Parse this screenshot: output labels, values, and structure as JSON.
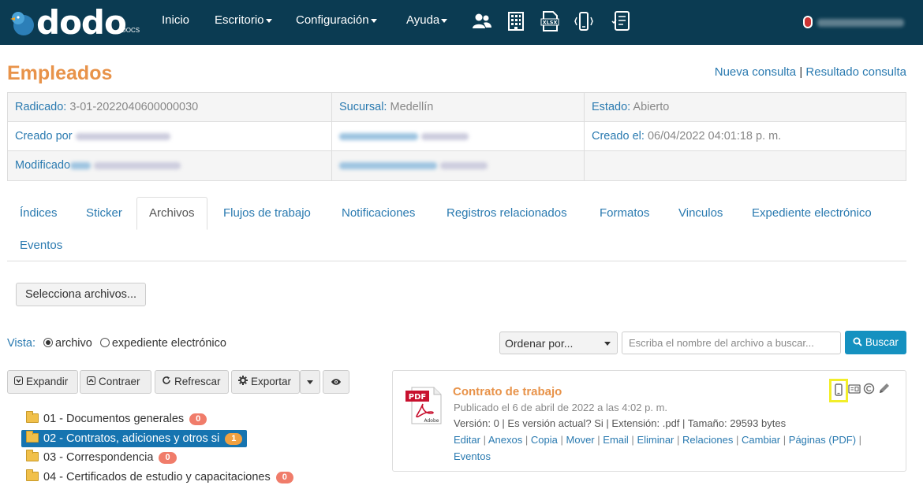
{
  "topbar": {
    "brand": "dodo",
    "brand_sub": "DOCS",
    "nav": [
      {
        "label": "Inicio"
      },
      {
        "label": "Escritorio"
      },
      {
        "label": "Configuración"
      },
      {
        "label": "Ayuda"
      }
    ],
    "icons": [
      "users-icon",
      "building-icon",
      "xlsx-icon",
      "mobile-vibrate-icon",
      "checklist-icon"
    ]
  },
  "page": {
    "title": "Empleados",
    "link_new": "Nueva consulta",
    "link_sep": "|",
    "link_result": "Resultado consulta"
  },
  "info": {
    "radicado_label": "Radicado:",
    "radicado_value": "3-01-2022040600000030",
    "sucursal_label": "Sucursal:",
    "sucursal_value": "Medellín",
    "estado_label": "Estado:",
    "estado_value": "Abierto",
    "creado_por_label": "Creado por",
    "creado_el_label": "Creado el:",
    "creado_el_value": "06/04/2022 04:01:18 p. m.",
    "modificado_label": "Modificado"
  },
  "tabs": [
    {
      "label": "Índices"
    },
    {
      "label": "Sticker"
    },
    {
      "label": "Archivos"
    },
    {
      "label": "Flujos de trabajo"
    },
    {
      "label": "Notificaciones"
    },
    {
      "label": "Registros relacionados"
    },
    {
      "label": "Formatos"
    },
    {
      "label": "Vinculos"
    },
    {
      "label": "Expediente electrónico"
    },
    {
      "label": "Eventos"
    }
  ],
  "files": {
    "select_button": "Selecciona archivos...",
    "vista_label": "Vista:",
    "vista_option1": "archivo",
    "vista_option2": "expediente electrónico",
    "sort_label": "Ordenar por...",
    "search_placeholder": "Escriba el nombre del archivo a buscar...",
    "search_button": "Buscar"
  },
  "toolbar": {
    "expand": "Expandir",
    "collapse": "Contraer",
    "refresh": "Refrescar",
    "export": "Exportar"
  },
  "tree": [
    {
      "label": "01 - Documentos generales",
      "count": "0"
    },
    {
      "label": "02 - Contratos, adiciones y otros si",
      "count": "1"
    },
    {
      "label": "03 - Correspondencia",
      "count": "0"
    },
    {
      "label": "04 - Certificados de estudio y capacitaciones",
      "count": "0"
    }
  ],
  "file": {
    "title": "Contrato de trabajo",
    "published": "Publicado el 6 de abril de 2022 a las 4:02 p. m.",
    "details": "Versión: 0 | Es versión actual? Si | Extensión: .pdf | Tamaño: 29593 bytes",
    "links": [
      "Editar",
      "Anexos",
      "Copia",
      "Mover",
      "Email",
      "Eliminar",
      "Relaciones",
      "Cambiar",
      "Páginas (PDF)",
      "Eventos"
    ],
    "pdf_label": "PDF",
    "pdf_brand": "Adobe"
  }
}
